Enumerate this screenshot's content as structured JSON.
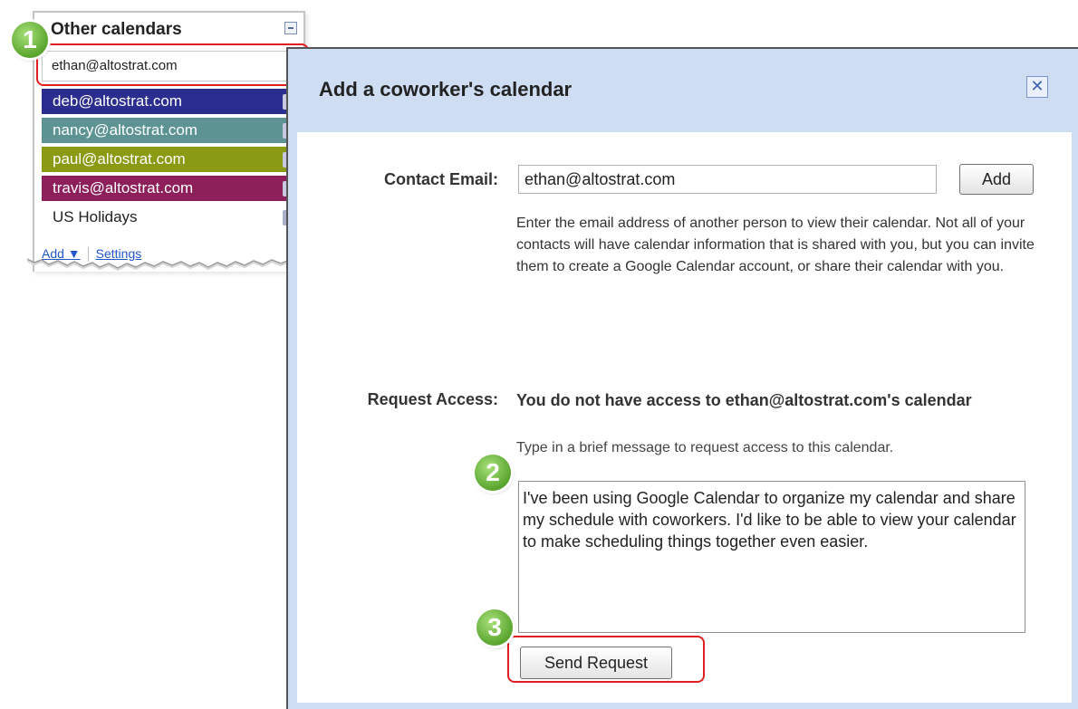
{
  "calendars_panel": {
    "title": "Other calendars",
    "search_value": "ethan@altostrat.com",
    "items": [
      {
        "label": "deb@altostrat.com",
        "color": "#2b2d8f"
      },
      {
        "label": "nancy@altostrat.com",
        "color": "#5d9493"
      },
      {
        "label": "paul@altostrat.com",
        "color": "#8b9a13"
      },
      {
        "label": "travis@altostrat.com",
        "color": "#8d1f5b"
      },
      {
        "label": "US Holidays",
        "color": ""
      }
    ],
    "add_label": "Add ▼",
    "settings_label": "Settings"
  },
  "dialog": {
    "title": "Add a coworker's calendar",
    "close_glyph": "✕",
    "contact_email_label": "Contact Email:",
    "contact_email_value": "ethan@altostrat.com",
    "add_button": "Add",
    "help_text": "Enter the email address of another person to view their calendar. Not all of your contacts will have calendar information that is shared with you, but you can invite them to create a Google Calendar account, or share their calendar with you.",
    "request_access_label": "Request Access:",
    "access_title": "You do not have access to ethan@altostrat.com's calendar",
    "access_hint": "Type in a brief message to request access to this calendar.",
    "message": "I've been using Google Calendar to organize my calendar and share my schedule with coworkers. I'd like to be able to view your calendar to make scheduling things together even easier.",
    "send_button": "Send Request"
  },
  "steps": [
    "1",
    "2",
    "3"
  ],
  "colors": {
    "dialog_frame": "#cfddf3",
    "highlight": "#e02020",
    "badge": "#5aa52e"
  }
}
